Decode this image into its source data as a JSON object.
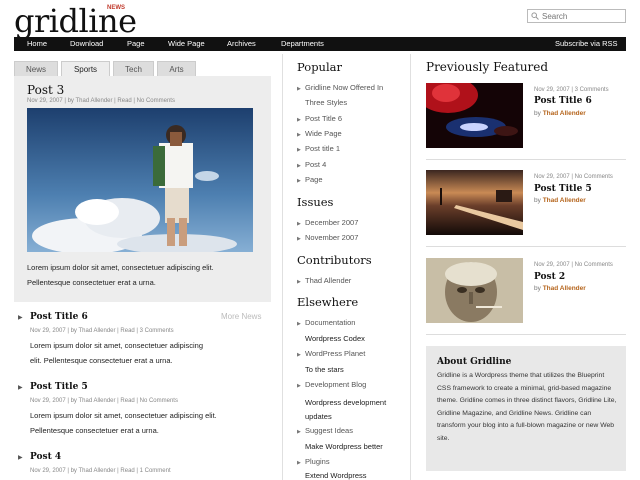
{
  "header": {
    "logo": "gridline",
    "logo_badge": "NEWS",
    "search_placeholder": "Search"
  },
  "nav": {
    "left": [
      "Home",
      "Download",
      "Page",
      "Wide Page",
      "Archives",
      "Departments"
    ],
    "right": "Subscribe via RSS"
  },
  "tabs": [
    "News",
    "Sports",
    "Tech",
    "Arts"
  ],
  "active_tab": "Sports",
  "featured": {
    "title": "Post 3",
    "meta": "Nov 29, 2007 | by Thad Allender | Read | No Comments",
    "text": [
      "Lorem ipsum dolor sit amet, consectetuer adipiscing elit.",
      "Pellentesque consectetuer erat a urna."
    ]
  },
  "more_news": "More News",
  "news_list": [
    {
      "title": "Post Title 6",
      "meta": "Nov 29, 2007 | by Thad Allender | Read | 3 Comments",
      "text": [
        "Lorem ipsum dolor sit amet, consectetuer adipiscing",
        "elit. Pellentesque consectetuer erat a urna."
      ]
    },
    {
      "title": "Post Title 5",
      "meta": "Nov 29, 2007 | by Thad Allender | Read | No Comments",
      "text": [
        "Lorem ipsum dolor sit amet, consectetuer adipiscing elit.",
        "Pellentesque consectetuer erat a urna."
      ]
    },
    {
      "title": "Post 4",
      "meta": "Nov 29, 2007 | by Thad Allender | Read | 1 Comment",
      "text": []
    }
  ],
  "sidebar": {
    "popular_heading": "Popular",
    "popular": [
      "Gridline Now Offered In",
      "Three Styles",
      "Post Title 6",
      "Wide Page",
      "Post title 1",
      "Post 4",
      "Page"
    ],
    "issues_heading": "Issues",
    "issues": [
      "December 2007",
      "November 2007"
    ],
    "contributors_heading": "Contributors",
    "contributors": [
      "Thad Allender"
    ],
    "elsewhere_heading": "Elsewhere",
    "elsewhere": [
      {
        "link": "Documentation",
        "sub": "Wordpress Codex"
      },
      {
        "link": "WordPress Planet",
        "sub": "To the stars"
      },
      {
        "link": "Development Blog",
        "sub": "Wordpress development updates"
      },
      {
        "link": "Suggest Ideas",
        "sub": "Make Wordpress better"
      },
      {
        "link": "Plugins",
        "sub": "Extend Wordpress"
      }
    ]
  },
  "previously_featured": {
    "heading": "Previously Featured",
    "items": [
      {
        "meta": "Nov 29, 2007 | 3 Comments",
        "title": "Post Title 6",
        "by": "by",
        "author": "Thad Allender"
      },
      {
        "meta": "Nov 29, 2007 | No Comments",
        "title": "Post Title 5",
        "by": "by",
        "author": "Thad Allender"
      },
      {
        "meta": "Nov 29, 2007 | No Comments",
        "title": "Post 2",
        "by": "by",
        "author": "Thad Allender"
      }
    ]
  },
  "about": {
    "title": "About Gridline",
    "text": "Gridline is a Wordpress theme that utilizes the Blueprint CSS framework to create a minimal, grid-based magazine theme. Gridline comes in three distinct flavors, Gridline Lite, Gridline Magazine, and Gridline News. Gridline can transform your blog into a full-blown magazine or new Web site."
  },
  "colors": {
    "nav_bg": "#111111",
    "accent_author": "#b5651d",
    "badge": "#c0392b",
    "panel_bg": "#ededed"
  }
}
